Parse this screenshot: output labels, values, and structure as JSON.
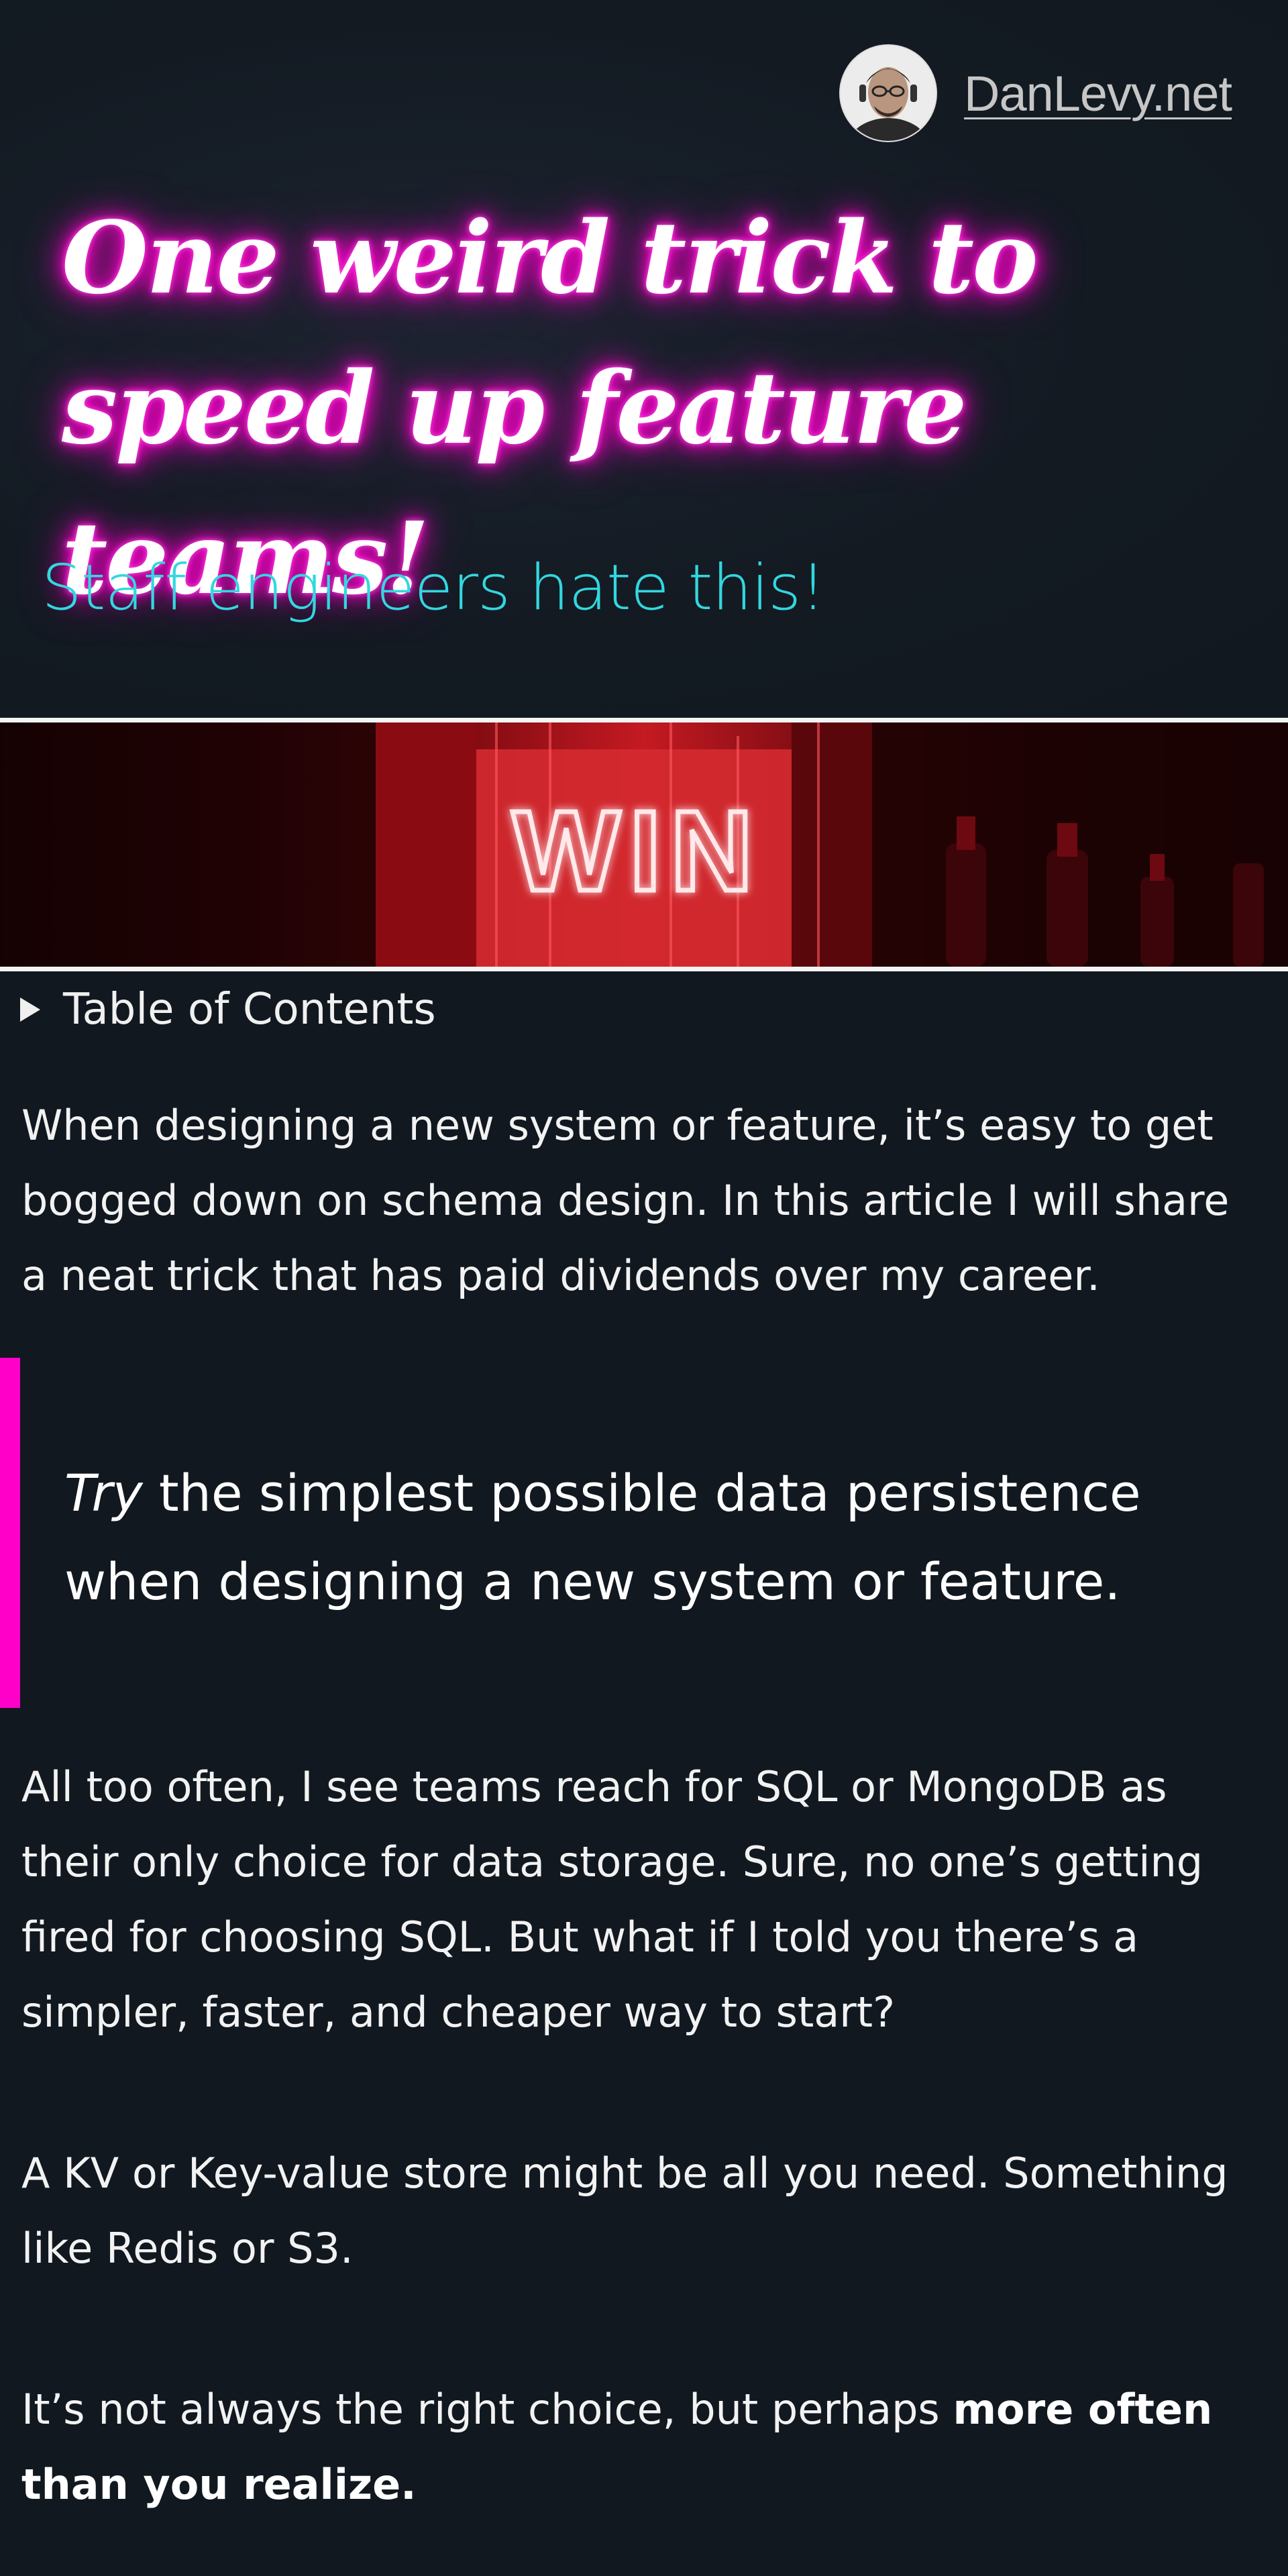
{
  "site": {
    "name": "DanLevy.net"
  },
  "hero": {
    "title_line1": "One weird trick to",
    "title_line2": "speed up feature teams!",
    "subtitle": "Staff engineers hate this!"
  },
  "banner": {
    "neon_text": "WIN"
  },
  "toc": {
    "label": "Table of Contents"
  },
  "article": {
    "intro": "When designing a new system or feature, it’s easy to get bogged down on schema design. In this article I will share a neat trick that has paid dividends over my career.",
    "quote_em": "Try",
    "quote_rest": " the simplest possible data persistence when designing a new system or feature.",
    "para2": "All too often, I see teams reach for SQL or MongoDB as their only choice for data storage. Sure, no one’s getting fired for choosing SQL. But what if I told you there’s a simpler, faster, and cheaper way to start?",
    "para3": "A KV or Key-value store might be all you need. Something like Redis or S3.",
    "para4_start": "It’s not always the right choice, but perhaps ",
    "para4_bold": "more often than you realize."
  },
  "colors": {
    "background": "#111820",
    "neon_pink": "#ff00c8",
    "cyan": "#33d7df",
    "banner_red": "#c41a22"
  },
  "icons": [
    "avatar-photo",
    "disclosure-triangle-icon"
  ]
}
